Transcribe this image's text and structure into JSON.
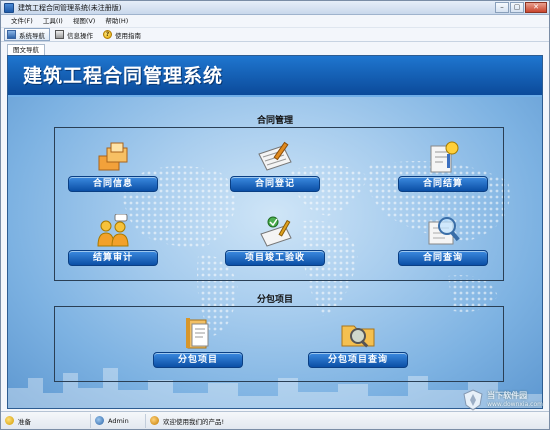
{
  "window": {
    "title": "建筑工程合同管理系统(未注册版)",
    "controls": [
      "–",
      "▢",
      "✕"
    ]
  },
  "menu": [
    "文件(F)",
    "工具(I)",
    "视图(V)",
    "帮助(H)"
  ],
  "toolbar": {
    "items": [
      {
        "label": "系统导航",
        "icon": "nav-icon"
      },
      {
        "label": "信息操作",
        "icon": "info-icon"
      },
      {
        "label": "使用指南",
        "icon": "help-icon"
      }
    ]
  },
  "tab": {
    "label": "图文导航"
  },
  "banner": {
    "title": "建筑工程合同管理系统"
  },
  "sections": {
    "contract": {
      "title": "合同管理",
      "modules": [
        {
          "label": "合同信息",
          "icon": "contract-info-icon"
        },
        {
          "label": "合同登记",
          "icon": "contract-register-icon"
        },
        {
          "label": "合同结算",
          "icon": "contract-settlement-icon"
        },
        {
          "label": "结算审计",
          "icon": "settlement-audit-icon"
        },
        {
          "label": "项目竣工验收",
          "icon": "project-acceptance-icon"
        },
        {
          "label": "合同查询",
          "icon": "contract-query-icon"
        }
      ]
    },
    "subcontract": {
      "title": "分包项目",
      "modules": [
        {
          "label": "分包项目",
          "icon": "subcontract-project-icon"
        },
        {
          "label": "分包项目查询",
          "icon": "subcontract-query-icon"
        }
      ]
    }
  },
  "status": {
    "ready": "准备",
    "user": "Admin",
    "message": "欢迎使用我们的产品!"
  },
  "watermark": {
    "name": "当下软件园",
    "url": "www.downxia.com"
  },
  "colors": {
    "banner": "#0b4a9a",
    "button": "#1a64bf",
    "panel_light": "#cfe5f7",
    "panel_dark": "#5d97d0"
  }
}
